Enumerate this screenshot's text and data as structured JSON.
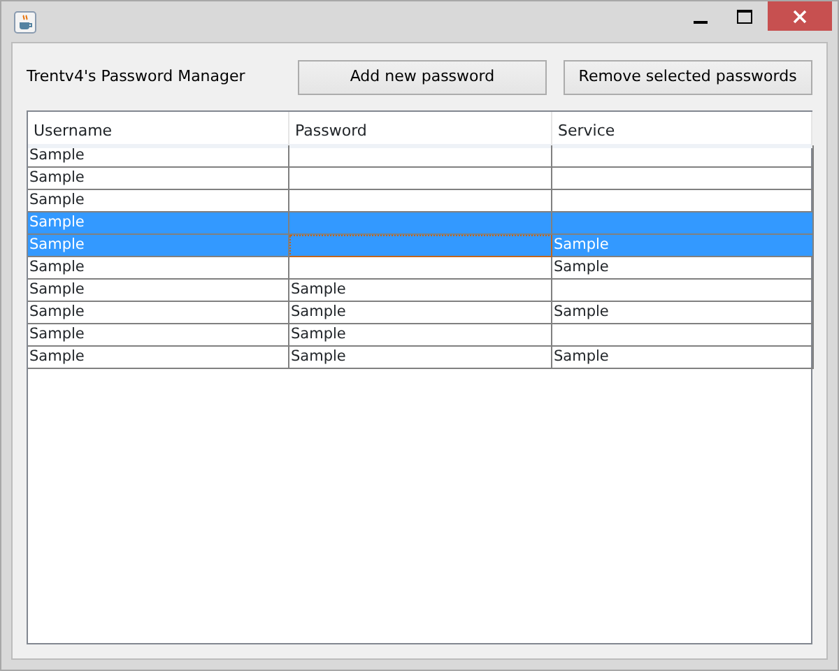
{
  "header": {
    "title": "Trentv4's Password Manager",
    "buttons": [
      "Add new password",
      "Remove selected passwords"
    ]
  },
  "table": {
    "columns": [
      "Username",
      "Password",
      "Service"
    ],
    "rows": [
      {
        "selected": false,
        "cells": [
          {
            "text": "Sample",
            "focused": false
          },
          {
            "focused": false
          },
          {
            "focused": false
          }
        ]
      },
      {
        "selected": false,
        "cells": [
          {
            "text": "Sample",
            "focused": false
          },
          {
            "focused": false
          },
          {
            "focused": false
          }
        ]
      },
      {
        "selected": false,
        "cells": [
          {
            "text": "Sample",
            "focused": false
          },
          {
            "focused": false
          },
          {
            "focused": false
          }
        ]
      },
      {
        "selected": true,
        "cells": [
          {
            "text": "Sample",
            "focused": false
          },
          {
            "focused": false
          },
          {
            "focused": false
          }
        ]
      },
      {
        "selected": true,
        "cells": [
          {
            "text": "Sample",
            "focused": false
          },
          {
            "focused": true
          },
          {
            "text": "Sample",
            "focused": false
          }
        ]
      },
      {
        "selected": false,
        "cells": [
          {
            "text": "Sample",
            "focused": false
          },
          {
            "focused": false
          },
          {
            "text": "Sample",
            "focused": false
          }
        ]
      },
      {
        "selected": false,
        "cells": [
          {
            "text": "Sample",
            "focused": false
          },
          {
            "text": "Sample",
            "focused": false
          },
          {
            "focused": false
          }
        ]
      },
      {
        "selected": false,
        "cells": [
          {
            "text": "Sample",
            "focused": false
          },
          {
            "text": "Sample",
            "focused": false
          },
          {
            "text": "Sample",
            "focused": false
          }
        ]
      },
      {
        "selected": false,
        "cells": [
          {
            "text": "Sample",
            "focused": false
          },
          {
            "text": "Sample",
            "focused": false
          },
          {
            "focused": false
          }
        ]
      },
      {
        "selected": false,
        "cells": [
          {
            "text": "Sample",
            "focused": false
          },
          {
            "text": "Sample",
            "focused": false
          },
          {
            "text": "Sample",
            "focused": false
          }
        ]
      }
    ]
  }
}
